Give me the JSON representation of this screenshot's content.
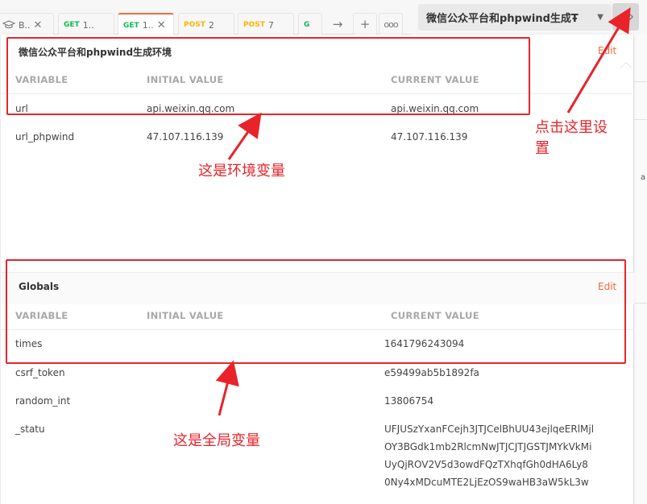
{
  "tabs": [
    {
      "method": "",
      "label": "B..",
      "icon": "graduation-cap-icon"
    },
    {
      "method": "GET",
      "label": "1.."
    },
    {
      "method": "GET",
      "label": "1..",
      "active": true
    },
    {
      "method": "POST",
      "label": "2"
    },
    {
      "method": "POST",
      "label": "7"
    },
    {
      "method": "G",
      "label": ""
    }
  ],
  "environment": {
    "selected": "微信公众平台和phpwind生成Ŧ",
    "title": "微信公众平台和phpwind生成环境",
    "edit_label": "Edit",
    "columns": [
      "VARIABLE",
      "INITIAL VALUE",
      "CURRENT VALUE"
    ],
    "rows": [
      {
        "variable": "url",
        "initial": "api.weixin.qq.com",
        "current": "api.weixin.qq.com"
      },
      {
        "variable": "url_phpwind",
        "initial": "47.107.116.139",
        "current": "47.107.116.139"
      }
    ]
  },
  "globals": {
    "title": "Globals",
    "edit_label": "Edit",
    "columns": [
      "VARIABLE",
      "INITIAL VALUE",
      "CURRENT VALUE"
    ],
    "rows": [
      {
        "variable": "times",
        "initial": "",
        "current": "1641796243094"
      },
      {
        "variable": "csrf_token",
        "initial": "",
        "current": "e59499ab5b1892fa"
      },
      {
        "variable": "random_int",
        "initial": "",
        "current": "13806754"
      },
      {
        "variable": "_statu",
        "initial": "",
        "current_lines": [
          "UFJUSzYxanFCejh3JTJCelBhUU43ejlqeERlMjl",
          "OY3BGdk1mb2RlcmNwJTJCJTJGSTJMYkVkMi",
          "UyQjROV2V5d3owdFQzTXhqfGh0dHA6Ly8",
          "0Ny4xMDcuMTE2LjEzOS9waHB3aW5kL3w"
        ]
      }
    ]
  },
  "annotations": {
    "env_label": "这是环境变量",
    "globals_label": "这是全局变量",
    "settings_label_line1": "点击这里设",
    "settings_label_line2": "置"
  },
  "right_fragment": "a",
  "colors": {
    "accent": "#f26b3a",
    "get": "#0cbb52",
    "post": "#ffb400",
    "annotation": "#e8242a"
  }
}
